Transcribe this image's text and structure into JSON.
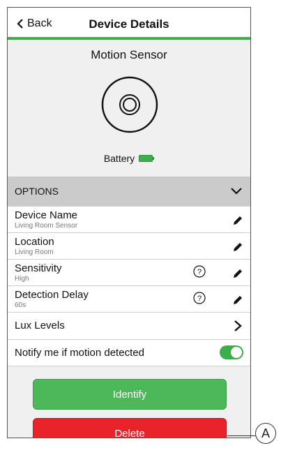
{
  "header": {
    "back_label": "Back",
    "title": "Device Details"
  },
  "device": {
    "name": "Motion Sensor",
    "battery_label": "Battery"
  },
  "options": {
    "label": "OPTIONS"
  },
  "rows": [
    {
      "label": "Device Name",
      "value": "Living Room Sensor"
    },
    {
      "label": "Location",
      "value": "Living Room"
    },
    {
      "label": "Sensitivity",
      "value": "High"
    },
    {
      "label": "Detection Delay",
      "value": "60s"
    },
    {
      "label": "Lux Levels"
    },
    {
      "label": "Notify me if motion detected",
      "toggle_on": true
    }
  ],
  "buttons": {
    "identify": "Identify",
    "delete": "Delete"
  },
  "callout": {
    "letter": "A"
  },
  "colors": {
    "accent": "#3dae49",
    "identify": "#4cb85a",
    "delete": "#e8232a",
    "options_bg": "#cbcbcb"
  }
}
